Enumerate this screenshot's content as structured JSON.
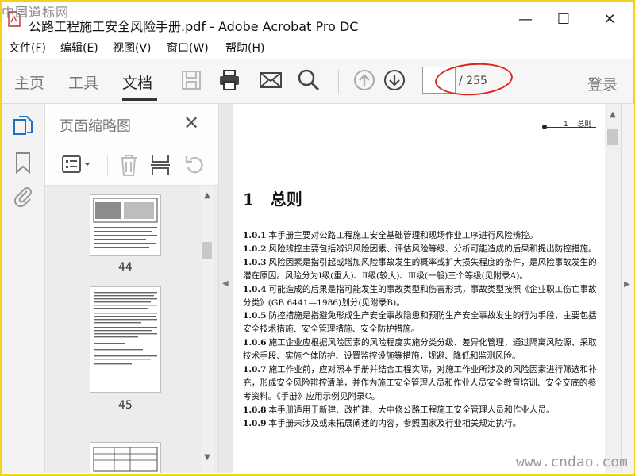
{
  "window": {
    "title": "公路工程施工安全风险手册.pdf - Adobe Acrobat Pro DC",
    "watermark_top": "中国道标网",
    "watermark_bottom": "www.cndao.com"
  },
  "menu": [
    "文件(F)",
    "编辑(E)",
    "视图(V)",
    "窗口(W)",
    "帮助(H)"
  ],
  "toolbar": {
    "tabs": [
      "主页",
      "工具",
      "文档"
    ],
    "active_tab": "文档",
    "page_input": "",
    "page_total": "/ 255",
    "login": "登录",
    "icons": [
      "save-icon",
      "print-icon",
      "email-icon",
      "search-icon",
      "page-up-icon",
      "page-down-icon"
    ]
  },
  "panel": {
    "title": "页面缩略图",
    "thumbnails": [
      {
        "label": "44"
      },
      {
        "label": "45"
      }
    ]
  },
  "document": {
    "running_head": "1    总则",
    "chapter_title": "1   总则",
    "paragraphs": [
      {
        "num": "1.0.1",
        "text": "本手册主要对公路工程施工安全基础管理和现场作业工序进行风险辨控。"
      },
      {
        "num": "1.0.2",
        "text": "风险辨控主要包括辨识风险因素、评估风险等级、分析可能造成的后果和提出防控措施。"
      },
      {
        "num": "1.0.3",
        "text": "风险因素是指引起或增加风险事故发生的概率或扩大损失程度的条件，是风险事故发生的潜在原因。风险分为Ⅰ级(重大)、Ⅱ级(较大)、Ⅲ级(一般)三个等级(见附录A)。"
      },
      {
        "num": "1.0.4",
        "text": "可能造成的后果是指可能发生的事故类型和伤害形式，事故类型按照《企业职工伤亡事故分类》(GB 6441—1986)划分(见附录B)。"
      },
      {
        "num": "1.0.5",
        "text": "防控措施是指避免形成生产安全事故隐患和预防生产安全事故发生的行为手段，主要包括安全技术措施、安全管理措施、安全防护措施。"
      },
      {
        "num": "1.0.6",
        "text": "施工企业应根据风险因素的风险程度实施分类分级、差异化管理，通过隔离风险源、采取技术手段、实施个体防护、设置监控设施等措施，规避、降低和监测风险。"
      },
      {
        "num": "1.0.7",
        "text": "施工作业前，应对照本手册并结合工程实际，对施工作业所涉及的风险因素进行筛选和补充，形成安全风险辨控清单，并作为施工安全管理人员和作业人员安全教育培训、安全交底的参考资料。《手册》应用示例见附录C。"
      },
      {
        "num": "1.0.8",
        "text": "本手册适用于新建、改扩建、大中修公路工程施工安全管理人员和作业人员。"
      },
      {
        "num": "1.0.9",
        "text": "本手册未涉及或未拓展阐述的内容，参照国家及行业相关规定执行。"
      }
    ]
  },
  "colors": {
    "annotation": "#d9271b",
    "frame": "#f3d21c",
    "accent": "#1a73c8"
  }
}
